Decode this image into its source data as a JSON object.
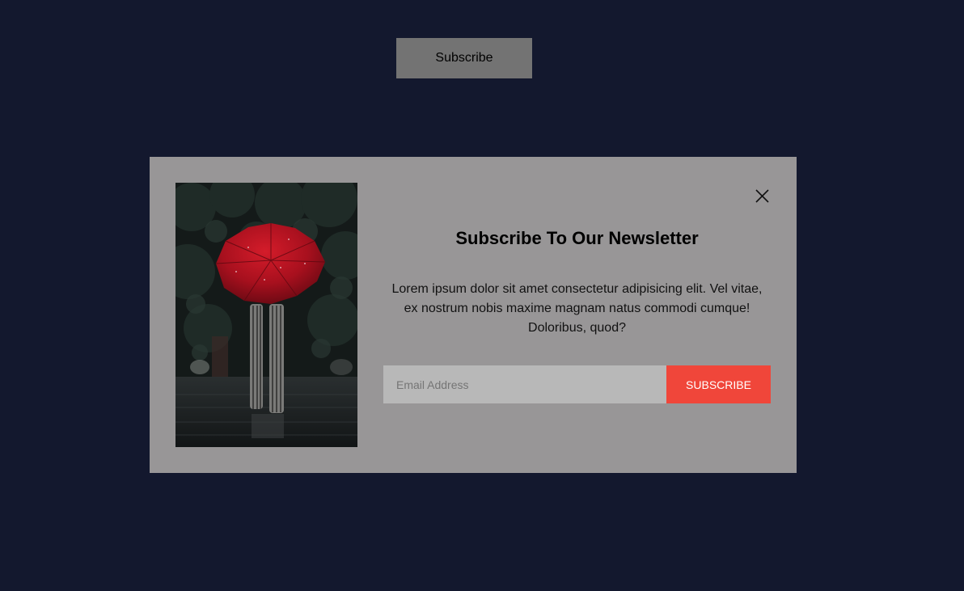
{
  "page": {
    "open_button_label": "Subscribe"
  },
  "modal": {
    "image_alt": "Person holding red umbrella in the rain",
    "close_icon": "close-icon",
    "title": "Subscribe To Our Newsletter",
    "description": "Lorem ipsum dolor sit amet consectetur adipisicing elit. Vel vitae, ex nostrum nobis maxime magnam natus commodi cumque! Doloribus, quod?",
    "email_placeholder": "Email Address",
    "email_value": "",
    "submit_label": "SUBSCRIBE"
  },
  "colors": {
    "page_background": "#13182e",
    "modal_background": "#989697",
    "accent": "#f0463a",
    "input_background": "#b8b8b8",
    "open_button_background": "#737373"
  }
}
